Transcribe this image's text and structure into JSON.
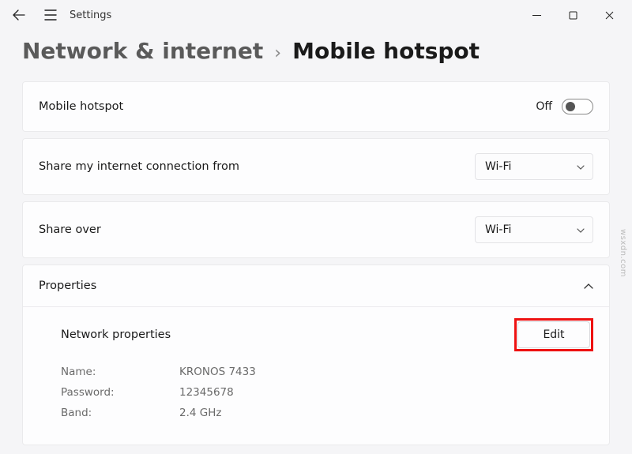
{
  "app": {
    "title": "Settings"
  },
  "breadcrumb": {
    "parent": "Network & internet",
    "sep": "›",
    "current": "Mobile hotspot"
  },
  "hotspot": {
    "label": "Mobile hotspot",
    "state": "Off"
  },
  "shareFrom": {
    "label": "Share my internet connection from",
    "value": "Wi-Fi"
  },
  "shareOver": {
    "label": "Share over",
    "value": "Wi-Fi"
  },
  "properties": {
    "header": "Properties",
    "networkPropsLabel": "Network properties",
    "editLabel": "Edit",
    "fields": {
      "nameLabel": "Name:",
      "nameValue": "KRONOS 7433",
      "passwordLabel": "Password:",
      "passwordValue": "12345678",
      "bandLabel": "Band:",
      "bandValue": "2.4 GHz"
    }
  },
  "watermark": "wsxdn.com"
}
